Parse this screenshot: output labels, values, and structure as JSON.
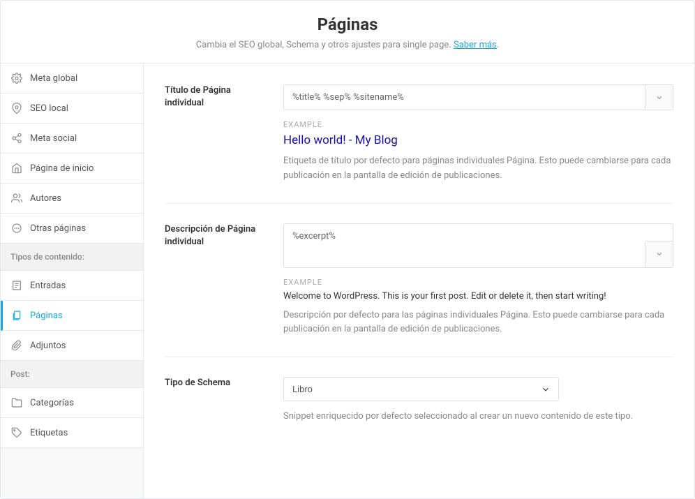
{
  "header": {
    "title": "Páginas",
    "subtitle": "Cambia el SEO global, Schema y otros ajustes para single page. ",
    "learn_more": "Saber más"
  },
  "sidebar": {
    "items": [
      {
        "label": "Meta global"
      },
      {
        "label": "SEO local"
      },
      {
        "label": "Meta social"
      },
      {
        "label": "Página de inicio"
      },
      {
        "label": "Autores"
      },
      {
        "label": "Otras páginas"
      }
    ],
    "group_content": "Tipos de contenido:",
    "content_items": [
      {
        "label": "Entradas"
      },
      {
        "label": "Páginas"
      },
      {
        "label": "Adjuntos"
      }
    ],
    "group_post": "Post:",
    "post_items": [
      {
        "label": "Categorías"
      },
      {
        "label": "Etiquetas"
      }
    ]
  },
  "fields": {
    "title": {
      "label": "Título de Página individual",
      "value": "%title% %sep% %sitename%",
      "example_label": "EXAMPLE",
      "example": "Hello world! - My Blog",
      "help": "Etiqueta de título por defecto para páginas individuales Página. Esto puede cambiarse para cada publicación en la pantalla de edición de publicaciones."
    },
    "desc": {
      "label": "Descripción de Página individual",
      "value": "%excerpt%",
      "example_label": "EXAMPLE",
      "example": "Welcome to WordPress. This is your first post. Edit or delete it, then start writing!",
      "help": "Descripción por defecto para las páginas individuales Página. Esto puede cambiarse para cada publicación en la pantalla de edición de publicaciones."
    },
    "schema": {
      "label": "Tipo de Schema",
      "value": "Libro",
      "help": "Snippet enriquecido por defecto seleccionado al crear un nuevo contenido de este tipo."
    }
  }
}
